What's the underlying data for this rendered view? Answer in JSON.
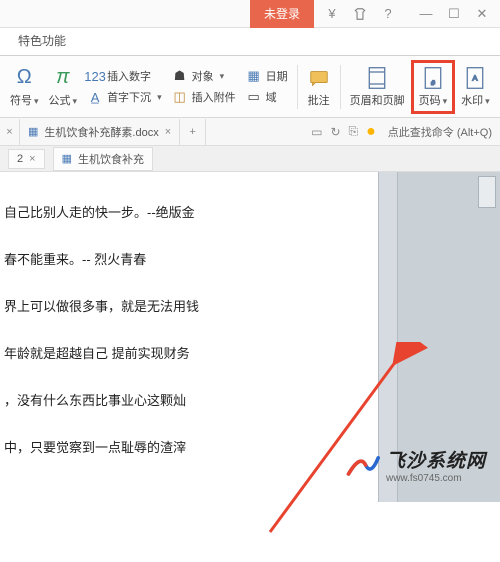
{
  "titlebar": {
    "login_badge": "未登录"
  },
  "tabstrip": {
    "special": "特色功能"
  },
  "ribbon": {
    "symbol": {
      "label": "符号",
      "glyph": "Ω"
    },
    "formula": {
      "label": "公式",
      "glyph": "π"
    },
    "insert_number": "插入数字",
    "dropcap": "首字下沉",
    "object": "对象",
    "attachment": "插入附件",
    "date": "日期",
    "field": "域",
    "comment": "批注",
    "header_footer": "页眉和页脚",
    "page_number": "页码",
    "watermark": "水印"
  },
  "doc_tabs": {
    "tab1_name": "生机饮食补充酵素.docx",
    "add": "+",
    "search_hint": "点此查找命令 (Alt+Q)"
  },
  "secondary": {
    "tab_a_suffix": "2",
    "tab_b_name": "生机饮食补充"
  },
  "content": {
    "l1": "自己比别人走的快一步。--绝版金",
    "l2": "春不能重来。-- 烈火青春",
    "l3": "界上可以做很多事，就是无法用钱",
    "l4": "年龄就是超越自己  提前实现财务",
    "l5": "，没有什么东西比事业心这颗灿",
    "l6": "中，只要觉察到一点耻辱的渣滓"
  },
  "watermark": {
    "title": "飞沙系统网",
    "url": "www.fs0745.com"
  }
}
